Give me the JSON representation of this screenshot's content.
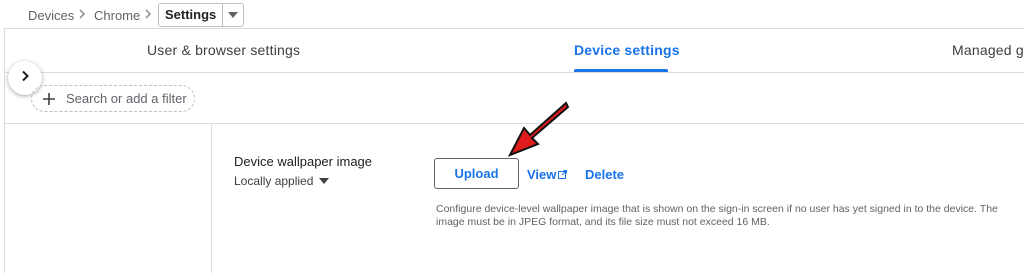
{
  "breadcrumb": {
    "items": [
      "Devices",
      "Chrome"
    ],
    "current": "Settings"
  },
  "tabs": [
    {
      "label": "User & browser settings",
      "active": false
    },
    {
      "label": "Device settings",
      "active": true
    },
    {
      "label": "Managed g",
      "active": false
    }
  ],
  "filter": {
    "placeholder": "Search or add a filter"
  },
  "setting": {
    "title": "Device wallpaper image",
    "scope": "Locally applied",
    "upload_label": "Upload",
    "view_label": "View",
    "delete_label": "Delete",
    "description": "Configure device-level wallpaper image that is shown on the sign-in screen if no user has yet signed in to the device. The image must be in JPEG format, and its file size must not exceed 16 MB."
  },
  "icons": {
    "expand": "chevron-right-icon",
    "filter_add": "plus-icon",
    "breadcrumb_sep": "chevron-right-icon",
    "dropdown": "caret-down-icon",
    "external": "open-in-new-icon",
    "annotation": "red-arrow-icon"
  },
  "colors": {
    "accent": "#1a73e8",
    "annotation": "#e01b1b",
    "divider": "#dadce0",
    "text_secondary": "#5f6368"
  }
}
